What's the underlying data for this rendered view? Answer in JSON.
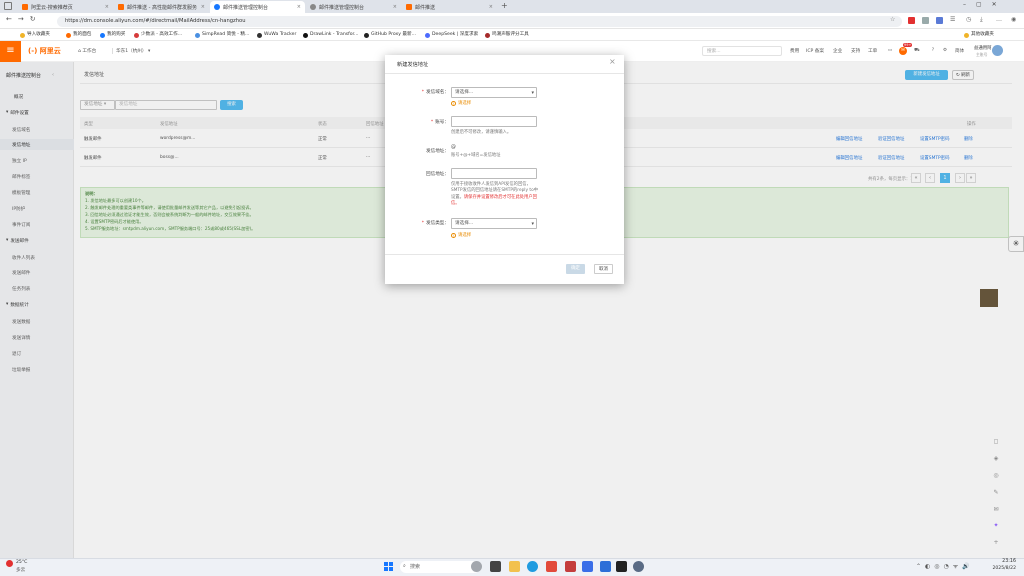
{
  "browser": {
    "tabs": [
      {
        "label": "阿里云-搜索推荐页",
        "color": "#ff6a00"
      },
      {
        "label": "邮件推送 - 高性能邮件群发服务",
        "color": "#ff6a00"
      },
      {
        "label": "邮件推送管理控制台",
        "color": "#1677ff"
      },
      {
        "label": "邮件推送管理控制台",
        "color": "#888888"
      },
      {
        "label": "邮件推送",
        "color": "#ff6a00"
      }
    ],
    "url": "https://dm.console.aliyun.com/#/directmail/MailAddress/cn-hangzhou",
    "bookmarks": [
      {
        "label": "导入收藏夹",
        "color": "#f0b429"
      },
      {
        "label": "我的面包",
        "color": "#ff6a00"
      },
      {
        "label": "我的购买",
        "color": "#1677ff"
      },
      {
        "label": "少数派 - 高效工作...",
        "color": "#d63b3b"
      },
      {
        "label": "SimpRead 简悦 - 精...",
        "color": "#4a90e2"
      },
      {
        "label": "WuWa Tracker",
        "color": "#333333"
      },
      {
        "label": "DrawLink - Transfor...",
        "color": "#111111"
      },
      {
        "label": "GitHub Proxy 最新...",
        "color": "#222222"
      },
      {
        "label": "DeepSeek | 深度求索",
        "color": "#4d6bfe"
      },
      {
        "label": "鸣潮声骸评分工具",
        "color": "#a52a2a"
      }
    ],
    "other_bookmarks": "其他收藏夹"
  },
  "console": {
    "menu_icon": "≡",
    "logo": "(-) 阿里云",
    "workbench": "工作台",
    "region": "华东1（杭州）",
    "search_placeholder": "搜索...",
    "header_links": [
      "费用",
      "ICP 备案",
      "企业",
      "支持",
      "工单"
    ],
    "user": {
      "name": "益通用阿",
      "sub": "主账号"
    },
    "lang": "简体",
    "badge": "99+"
  },
  "sidebar": {
    "title": "邮件推送控制台",
    "overview": "概况",
    "sections": [
      {
        "label": "邮件设置",
        "items": [
          "发信域名",
          "发信地址",
          "独立 IP",
          "邮件标签",
          "模板管理",
          "IP防护",
          "事件订阅"
        ]
      },
      {
        "label": "发送邮件",
        "items": [
          "收件人列表",
          "发送邮件",
          "任务列表"
        ]
      },
      {
        "label": "数据统计",
        "items": [
          "发送数据",
          "发送详情",
          "退订",
          "垃圾举报"
        ]
      }
    ]
  },
  "main": {
    "title": "发信地址",
    "new_button": "新建发信地址",
    "refresh_button": "刷新",
    "filter_select": "发信地址",
    "filter_placeholder": "发信地址",
    "search_button": "搜索",
    "columns": [
      "类型",
      "发信地址",
      "状态",
      "回信地址"
    ],
    "op_header": "操作",
    "rows": [
      {
        "type": "触发邮件",
        "address": "wordpress@m...",
        "status": "正常",
        "reply": "···",
        "ops": [
          "编辑回信地址",
          "验证回信地址",
          "设置SMTP密码",
          "删除"
        ]
      },
      {
        "type": "触发邮件",
        "address": "boss@...",
        "status": "正常",
        "reply": "···",
        "ops": [
          "编辑回信地址",
          "验证回信地址",
          "设置SMTP密码",
          "删除"
        ]
      }
    ],
    "pager": {
      "summary": "共有2条，每页显示：10条",
      "prev": "‹",
      "page": "1",
      "next": "›",
      "last": "»",
      "first": "«"
    },
    "tips_title": "说明：",
    "tips": [
      "1. 发信地址最多可以创建10个。",
      "2. 触发邮件处理的重要类事件等邮件，请使用批量邮件发送等其它产品，以避免引起投诉。",
      "3. 回信地址必须通过验证才能生效，否则会被系统判断为一般的邮件地址，交互效果不佳。",
      "4. 设置SMTP密码后才能使用。",
      "5. SMTP服务地址：smtpdm.aliyun.com，SMTP服务端口号：25或80或465(SSL加密)。"
    ]
  },
  "modal": {
    "title": "新建发信地址",
    "close": "×",
    "fields": [
      {
        "label": "发信域名：",
        "required": true,
        "value": "请选择...",
        "warn": "请选择"
      },
      {
        "label": "账号：",
        "required": true,
        "value": "",
        "hint": "创建后不可修改，请谨慎输入。"
      },
      {
        "label": "发信地址：",
        "required": false,
        "value": "@",
        "hint": "账号+@+域名=发信地址"
      },
      {
        "label": "回信地址：",
        "required": false,
        "value": "",
        "hint": "仅用于接收收件人发信到API发信的回信，SMTP发信的回信地址请在SMTP的reply to中设置。",
        "hint_red": "请保存并设置修改后才可在此处用户回信。"
      },
      {
        "label": "发信类型：",
        "required": true,
        "value": "请选择...",
        "warn": "请选择"
      }
    ],
    "ok": "确定",
    "cancel": "取消"
  },
  "taskbar": {
    "weather_temp": "25°C",
    "weather_desc": "多云",
    "search": "搜索",
    "time": "23:16",
    "date": "2025/8/22"
  }
}
